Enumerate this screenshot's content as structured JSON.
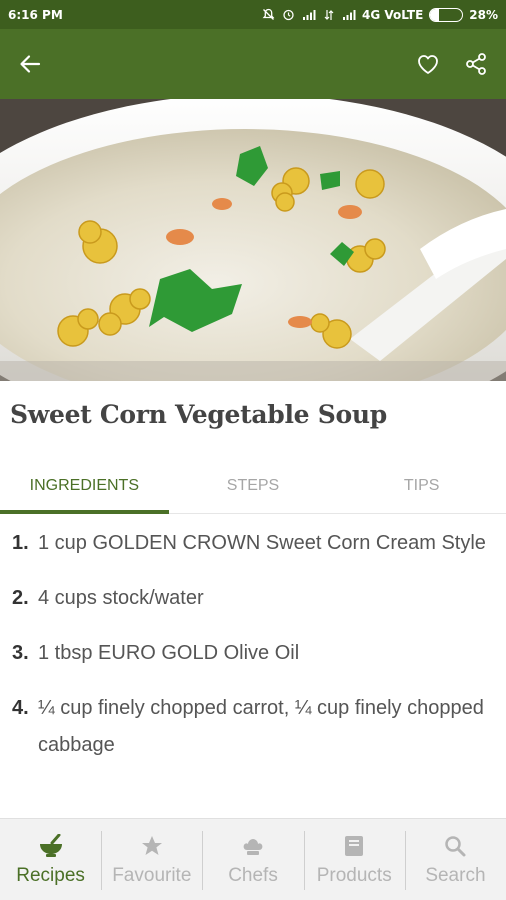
{
  "status_bar": {
    "time": "6:16 PM",
    "network": "4G VoLTE",
    "battery_percent": "28%",
    "battery_level": 0.28
  },
  "app_bar": {
    "back_icon": "arrow-left-icon",
    "favorite_icon": "heart-outline-icon",
    "share_icon": "share-icon"
  },
  "recipe": {
    "title": "Sweet Corn Vegetable Soup",
    "image_description_icon": "soup-bowl-photo"
  },
  "tabs": [
    {
      "label": "INGREDIENTS",
      "active": true
    },
    {
      "label": "STEPS",
      "active": false
    },
    {
      "label": "TIPS",
      "active": false
    }
  ],
  "ingredients": [
    {
      "number": "1.",
      "text": "1 cup GOLDEN CROWN Sweet Corn Cream Style"
    },
    {
      "number": "2.",
      "text": "4 cups stock/water"
    },
    {
      "number": "3.",
      "text": "1 tbsp EURO GOLD Olive Oil"
    },
    {
      "number": "4.",
      "text": "¼ cup finely chopped carrot, ¼ cup finely chopped cabbage"
    }
  ],
  "bottom_nav": [
    {
      "label": "Recipes",
      "icon": "mortar-bowl-icon",
      "active": true
    },
    {
      "label": "Favourite",
      "icon": "star-icon",
      "active": false
    },
    {
      "label": "Chefs",
      "icon": "chef-hat-icon",
      "active": false
    },
    {
      "label": "Products",
      "icon": "product-box-icon",
      "active": false
    },
    {
      "label": "Search",
      "icon": "search-icon",
      "active": false
    }
  ],
  "colors": {
    "status_bar": "#3d5e1e",
    "app_bar": "#4b7027",
    "accent": "#4b7027",
    "inactive": "#b5b5b5"
  }
}
